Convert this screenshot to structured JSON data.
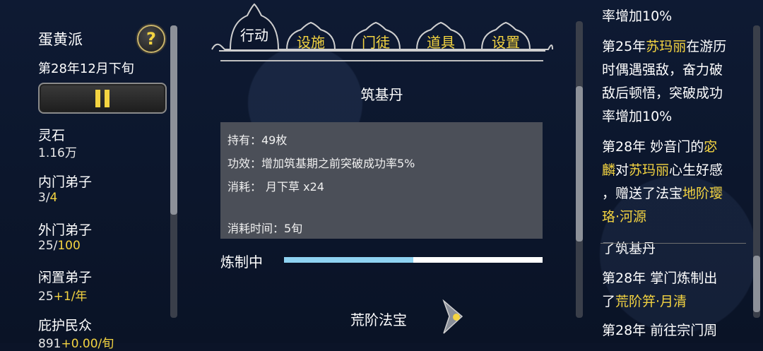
{
  "sidebar": {
    "sect_name": "蛋黄派",
    "date": "第28年12月下旬",
    "help_symbol": "?",
    "stats": [
      {
        "label": "灵石",
        "value": "1.16万",
        "value_extra": ""
      },
      {
        "label": "内门弟子",
        "value": "3/",
        "value_extra": "4"
      },
      {
        "label": "外门弟子",
        "value": "25/",
        "value_extra": "100"
      },
      {
        "label": "闲置弟子",
        "value": "25",
        "value_extra": "+1/年"
      },
      {
        "label": "庇护民众",
        "value": "891",
        "value_extra": "+0.00/旬"
      }
    ]
  },
  "tabs": [
    {
      "label": "行动",
      "active": true
    },
    {
      "label": "设施",
      "active": false
    },
    {
      "label": "门徒",
      "active": false
    },
    {
      "label": "道具",
      "active": false
    },
    {
      "label": "设置",
      "active": false
    }
  ],
  "item": {
    "name": "筑基丹",
    "owned": "持有：49枚",
    "effect": "功效：增加筑基期之前突破成功率5%",
    "cost_label": "消耗：",
    "cost_value": "月下草 x24",
    "time": "消耗时间：5旬"
  },
  "progress": {
    "label": "炼制中",
    "fraction": 0.5
  },
  "footer": {
    "label": "荒阶法宝"
  },
  "log": {
    "entries": [
      [
        {
          "t": "率增加10%",
          "hl": false
        }
      ],
      [
        {
          "t": "第25年",
          "hl": false
        },
        {
          "t": "苏玛丽",
          "hl": true
        },
        {
          "t": "在游历",
          "hl": false
        }
      ],
      [
        {
          "t": "时偶遇强敌，奋力破",
          "hl": false
        }
      ],
      [
        {
          "t": "敌后顿悟，突破成功",
          "hl": false
        }
      ],
      [
        {
          "t": "率增加10%",
          "hl": false
        }
      ],
      [
        {
          "t": "第28年 妙音门的",
          "hl": false
        },
        {
          "t": "宓",
          "hl": true
        }
      ],
      [
        {
          "t": "麟",
          "hl": true
        },
        {
          "t": "对",
          "hl": false
        },
        {
          "t": "苏玛丽",
          "hl": true
        },
        {
          "t": "心生好感",
          "hl": false
        }
      ],
      [
        {
          "t": "，赠送了法宝",
          "hl": false
        },
        {
          "t": "地阶璎",
          "hl": true
        }
      ],
      [
        {
          "t": "珞·河源",
          "hl": true
        }
      ],
      [
        {
          "t": "了筑基丹",
          "hl": false
        }
      ],
      [
        {
          "t": "第28年 掌门炼制出",
          "hl": false
        }
      ],
      [
        {
          "t": "了",
          "hl": false
        },
        {
          "t": "荒阶笄·月清",
          "hl": true
        }
      ],
      [
        {
          "t": "第28年 前往宗门周",
          "hl": false
        }
      ]
    ]
  },
  "colors": {
    "accent": "#f4d441",
    "progress": "#8fd3f2",
    "panel": "#4b4f58"
  }
}
